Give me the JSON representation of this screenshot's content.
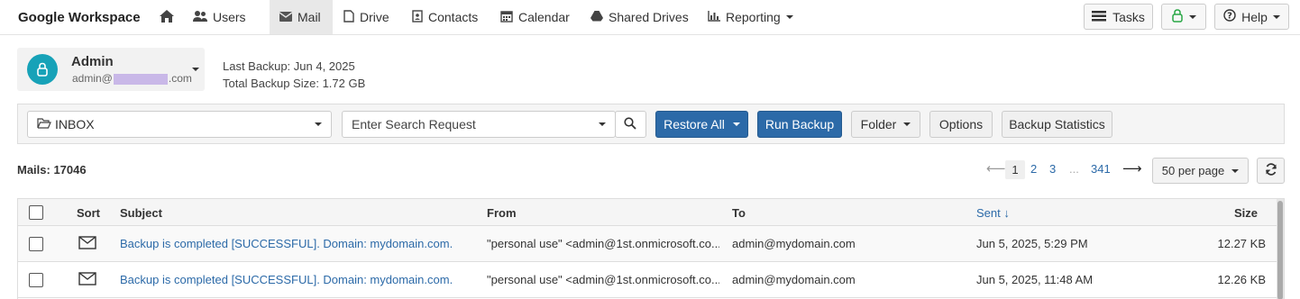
{
  "app": {
    "brand": "Google Workspace"
  },
  "nav": {
    "items": [
      {
        "label": "Users",
        "icon": "users-icon"
      },
      {
        "label": "Mail",
        "icon": "envelope-icon",
        "active": true
      },
      {
        "label": "Drive",
        "icon": "file-icon"
      },
      {
        "label": "Contacts",
        "icon": "contact-card-icon"
      },
      {
        "label": "Calendar",
        "icon": "calendar-icon"
      },
      {
        "label": "Shared Drives",
        "icon": "drive-icon"
      },
      {
        "label": "Reporting",
        "icon": "bar-chart-icon"
      }
    ],
    "tasks": "Tasks",
    "help": "Help"
  },
  "account": {
    "name": "Admin",
    "email_prefix": "admin@",
    "email_suffix": ".com"
  },
  "backup": {
    "last_label": "Last Backup:",
    "last_value": "Jun 4, 2025",
    "size_label": "Total Backup Size:",
    "size_value": "1.72 GB"
  },
  "toolbar": {
    "folder_select": "INBOX",
    "search_placeholder": "Enter Search Request",
    "restore_all": "Restore All",
    "run_backup": "Run Backup",
    "folder": "Folder",
    "options": "Options",
    "backup_statistics": "Backup Statistics"
  },
  "mails": {
    "count_label": "Mails: 17046"
  },
  "pagination": {
    "prev": "⟵",
    "current": "1",
    "pages": [
      "2",
      "3"
    ],
    "ellipsis": "...",
    "last": "341",
    "next": "⟶",
    "per_page": "50 per page"
  },
  "table": {
    "columns": {
      "sort": "Sort",
      "subject": "Subject",
      "from": "From",
      "to": "To",
      "sent": "Sent ↓",
      "size": "Size"
    },
    "rows": [
      {
        "subject": "Backup is completed [SUCCESSFUL]. Domain: mydomain.com.",
        "from": "\"personal use\" <admin@1st.onmicrosoft.co...",
        "to": "admin@mydomain.com",
        "sent": "Jun 5, 2025, 5:29 PM",
        "size": "12.27 KB"
      },
      {
        "subject": "Backup is completed [SUCCESSFUL]. Domain: mydomain.com.",
        "from": "\"personal use\" <admin@1st.onmicrosoft.co...",
        "to": "admin@mydomain.com",
        "sent": "Jun 5, 2025, 11:48 AM",
        "size": "12.26 KB"
      }
    ]
  },
  "colors": {
    "accent": "#2c6aa8",
    "avatar": "#17a2b8",
    "status_green": "#28a745"
  }
}
